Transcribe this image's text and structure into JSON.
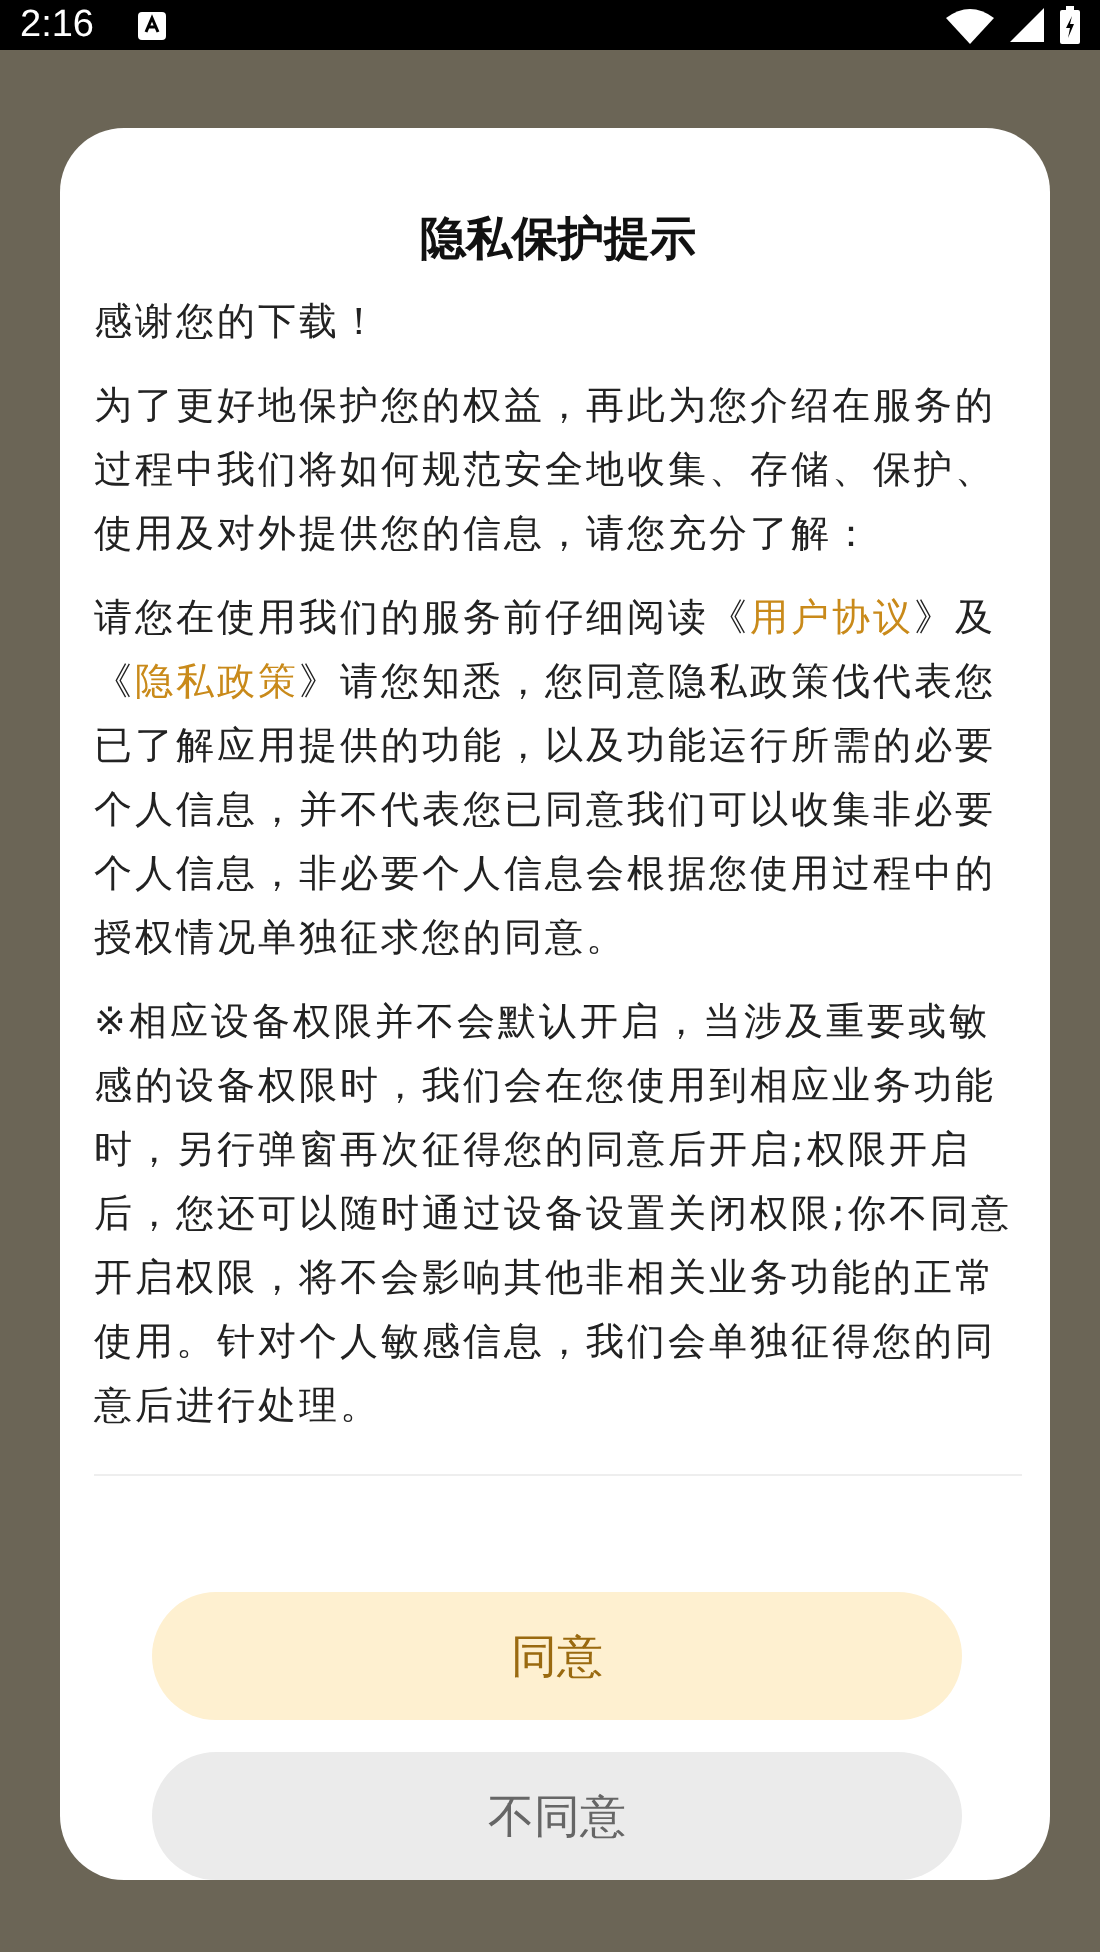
{
  "status_bar": {
    "time": "2:16"
  },
  "dialog": {
    "title": "隐私保护提示",
    "paragraphs": [
      {
        "segments": [
          {
            "kind": "text",
            "text": "感谢您的下载！"
          }
        ]
      },
      {
        "segments": [
          {
            "kind": "text",
            "text": "为了更好地保护您的权益，再此为您介绍在服务的过程中我们将如何规范安全地收集、存储、保护、使用及对外提供您的信息，请您充分了解："
          }
        ]
      },
      {
        "segments": [
          {
            "kind": "text",
            "text": "请您在使用我们的服务前仔细阅读《"
          },
          {
            "kind": "link",
            "text": "用户协议"
          },
          {
            "kind": "text",
            "text": "》及《"
          },
          {
            "kind": "link",
            "text": "隐私政策"
          },
          {
            "kind": "text",
            "text": "》请您知悉，您同意隐私政策伐代表您已了解应用提供的功能，以及功能运行所需的必要个人信息，并不代表您已同意我们可以收集非必要个人信息，非必要个人信息会根据您使用过程中的授权情况单独征求您的同意。"
          }
        ]
      },
      {
        "segments": [
          {
            "kind": "text",
            "text": "※相应设备权限并不会默认开启，当涉及重要或敏感的设备权限时，我们会在您使用到相应业务功能时，另行弹窗再次征得您的同意后开启;权限开启后，您还可以随时通过设备设置关闭权限;你不同意开启权限，将不会影响其他非相关业务功能的正常使用。针对个人敏感信息，我们会单独征得您的同意后进行处理。"
          }
        ]
      }
    ],
    "buttons": [
      {
        "label": "同意",
        "kind": "primary"
      },
      {
        "label": "不同意",
        "kind": "secondary"
      }
    ]
  }
}
